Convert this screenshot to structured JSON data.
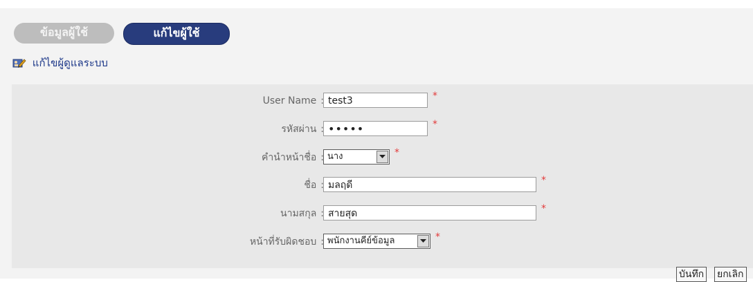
{
  "tabs": [
    {
      "label": "ข้อมูลผู้ใช้",
      "active": false
    },
    {
      "label": "แก้ไขผู้ใช้",
      "active": true
    }
  ],
  "section_title": "แก้ไขผู้ดูแลระบบ",
  "section_icon": "edit-user-icon",
  "form": {
    "username": {
      "label": "User Name",
      "value": "test3"
    },
    "password": {
      "label": "รหัสผ่าน",
      "value": "•••••"
    },
    "prefix": {
      "label": "คำนำหน้าชื่อ",
      "value": "นาง"
    },
    "first_name": {
      "label": "ชื่อ",
      "value": "มลฤดี"
    },
    "last_name": {
      "label": "นามสกุล",
      "value": "สายสุด"
    },
    "role": {
      "label": "หน้าที่รับผิดชอบ",
      "value": "พนักงานคีย์ข้อมูล"
    },
    "colon": ":",
    "required_mark": "*"
  },
  "buttons": {
    "save": "บันทึก",
    "cancel": "ยกเลิก"
  },
  "colors": {
    "active_tab": "#283c7d",
    "inactive_tab": "#bdbdbd",
    "required": "#e23b3b",
    "title": "#1f3a8a"
  }
}
